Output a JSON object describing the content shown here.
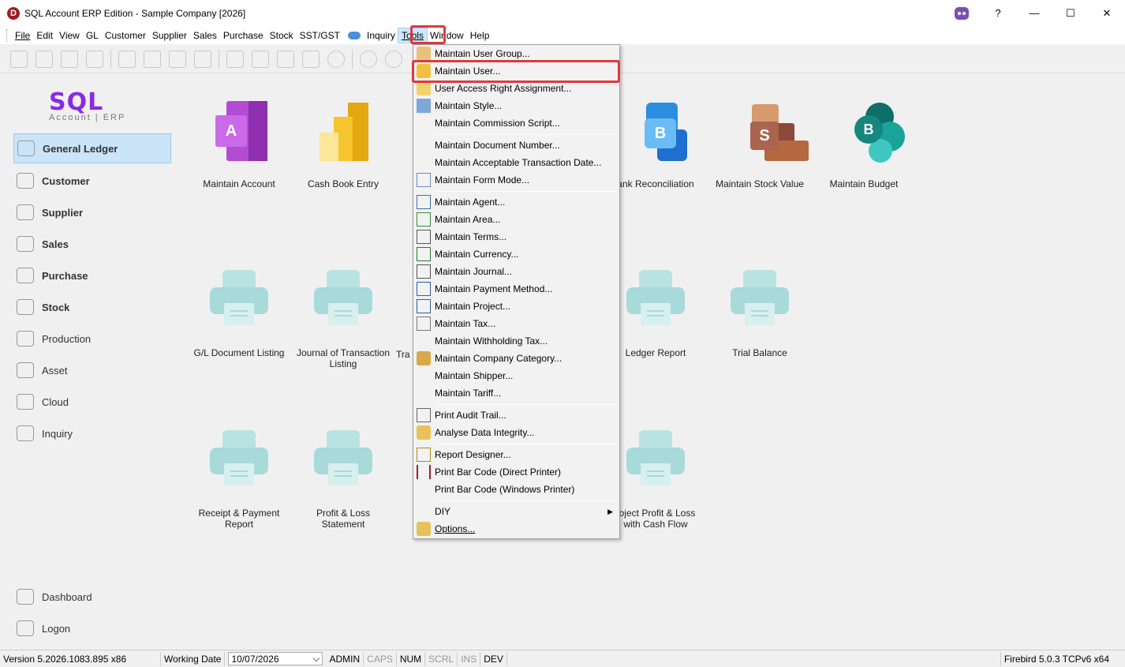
{
  "window": {
    "title": "SQL Account ERP Edition - Sample Company [2026]",
    "help": "?",
    "minimize": "—",
    "maximize": "☐",
    "close": "✕"
  },
  "menu": [
    "File",
    "Edit",
    "View",
    "GL",
    "Customer",
    "Supplier",
    "Sales",
    "Purchase",
    "Stock",
    "SST/GST",
    "Inquiry",
    "Tools",
    "Window",
    "Help"
  ],
  "brand": {
    "name": "SQL",
    "sub": "Account | ERP"
  },
  "sidebar": [
    {
      "label": "General Ledger",
      "icon": "ledger-icon"
    },
    {
      "label": "Customer",
      "icon": "customer-icon"
    },
    {
      "label": "Supplier",
      "icon": "supplier-icon"
    },
    {
      "label": "Sales",
      "icon": "sales-icon"
    },
    {
      "label": "Purchase",
      "icon": "purchase-icon"
    },
    {
      "label": "Stock",
      "icon": "stock-icon"
    },
    {
      "label": "Production",
      "icon": "production-icon"
    },
    {
      "label": "Asset",
      "icon": "asset-icon"
    },
    {
      "label": "Cloud",
      "icon": "cloud-icon"
    },
    {
      "label": "Inquiry",
      "icon": "inquiry-icon"
    },
    {
      "label": "Dashboard",
      "icon": "dashboard-icon"
    },
    {
      "label": "Logon",
      "icon": "logon-icon"
    }
  ],
  "tiles": [
    {
      "label": "Maintain Account",
      "icon": "account-icon"
    },
    {
      "label": "Cash Book Entry",
      "icon": "cashbook-icon"
    },
    {
      "label": "ank Reconciliation",
      "icon": "bank-reconciliation-icon"
    },
    {
      "label": "Maintain Stock Value",
      "icon": "stock-value-icon"
    },
    {
      "label": "Maintain Budget",
      "icon": "budget-icon"
    },
    {
      "label": "G/L Document Listing",
      "icon": "printer-icon"
    },
    {
      "label": "Journal of Transaction Listing",
      "icon": "printer-icon"
    },
    {
      "label": "Tra",
      "icon": ""
    },
    {
      "label": "Ledger Report",
      "icon": "printer-icon"
    },
    {
      "label": "Trial Balance",
      "icon": "printer-icon"
    },
    {
      "label": "Receipt & Payment Report",
      "icon": "printer-icon"
    },
    {
      "label": "Profit & Loss Statement",
      "icon": "printer-icon"
    },
    {
      "label": "roject Profit & Loss with Cash Flow",
      "icon": "printer-icon"
    }
  ],
  "tools_menu": [
    "Maintain User Group...",
    "Maintain User...",
    "User Access Right Assignment...",
    "Maintain Style...",
    "Maintain Commission Script...",
    "Maintain Document Number...",
    "Maintain Acceptable Transaction Date...",
    "Maintain Form Mode...",
    "Maintain Agent...",
    "Maintain Area...",
    "Maintain Terms...",
    "Maintain Currency...",
    "Maintain Journal...",
    "Maintain Payment Method...",
    "Maintain Project...",
    "Maintain Tax...",
    "Maintain Withholding Tax...",
    "Maintain Company Category...",
    "Maintain Shipper...",
    "Maintain Tariff...",
    "Print Audit Trail...",
    "Analyse Data Integrity...",
    "Report Designer...",
    "Print Bar Code (Direct Printer)",
    "Print Bar Code (Windows Printer)",
    "DIY",
    "Options..."
  ],
  "status": {
    "version": "Version 5.2026.1083.895 x86",
    "working_date_label": "Working Date",
    "working_date": "10/07/2026",
    "user": "ADMIN",
    "caps": "CAPS",
    "num": "NUM",
    "scrl": "SCRL",
    "ins": "INS",
    "dev": "DEV",
    "db": "Firebird 5.0.3 TCPv6 x64"
  },
  "colors": {
    "highlight": "#e0383e",
    "brand": "#8a2be2",
    "selected": "#cce4f7"
  }
}
